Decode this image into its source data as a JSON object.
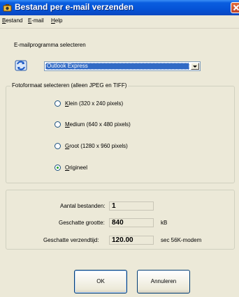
{
  "window": {
    "title": "Bestand per e-mail verzenden"
  },
  "menu": {
    "items": [
      "Bestand",
      "E-mail",
      "Help"
    ]
  },
  "email_program": {
    "label": "E-mailprogramma selecteren",
    "selected": "Outlook Express"
  },
  "photo_format": {
    "legend": "Fotoformaat selecteren (alleen JPEG en TIFF)",
    "options": [
      {
        "label": "Klein (320 x 240 pixels)",
        "checked": false
      },
      {
        "label": "Medium (640 x 480 pixels)",
        "checked": false
      },
      {
        "label": "Groot (1280 x 960 pixels)",
        "checked": false
      },
      {
        "label": "Origineel",
        "checked": true
      }
    ]
  },
  "stats": {
    "files_label": "Aantal bestanden:",
    "files_value": "1",
    "size_label": "Geschatte grootte:",
    "size_value": "840",
    "size_unit": "kB",
    "time_label": "Geschatte verzendtijd:",
    "time_value": "120.00",
    "time_unit": "sec 56K-modem"
  },
  "buttons": {
    "ok": "OK",
    "cancel": "Annuleren"
  },
  "colors": {
    "titlebar": "#0553d6",
    "selection": "#316ac5",
    "dialog_bg": "#ece9d8"
  }
}
